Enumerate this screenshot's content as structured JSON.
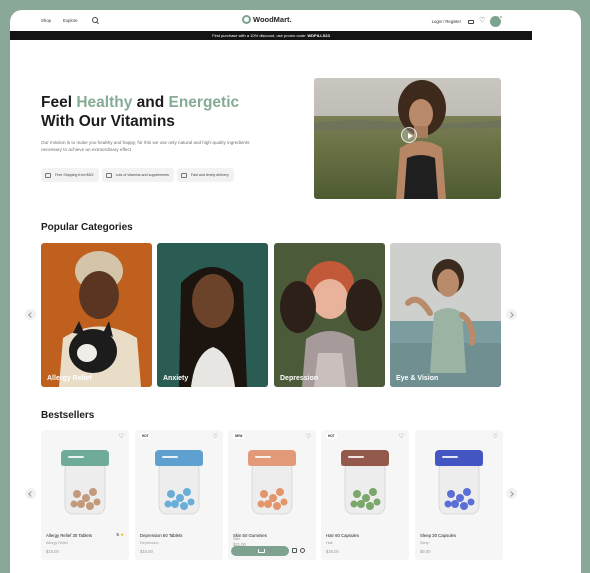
{
  "header": {
    "nav": [
      "Shop",
      "Explore"
    ],
    "logo": "WoodMart.",
    "login": "Login / Register",
    "cart_count": "0"
  },
  "promo": {
    "prefix": "First purchase with a 10% discount, use promo code: ",
    "code": "WDPILLS23"
  },
  "hero": {
    "title_part1": "Feel ",
    "title_green1": "Healthy",
    "title_part2": " and ",
    "title_green2": "Energetic",
    "title_line2": "With Our Vitamins",
    "description": "Our mission is to make you healthy and happy, for this we use only natural and high-quality ingredients necessary to achieve an extraordinary effect",
    "features": [
      "Free Shipping from $30!",
      "Lots of vitamins and supplements",
      "Fast and timely delivery"
    ]
  },
  "categories": {
    "title": "Popular Categories",
    "items": [
      "Allergy Relief",
      "Anxiety",
      "Depression",
      "Eye & Vision"
    ]
  },
  "bestsellers": {
    "title": "Bestsellers",
    "products": [
      {
        "name": "Allergy Relief 30 Tablets",
        "category": "Allergy Relief",
        "price": "$15.00",
        "rating": "5",
        "badge": "",
        "lid": "#6fab9a",
        "pill": "#c39b7c"
      },
      {
        "name": "Depression 60 Tablets",
        "category": "Depression",
        "price": "$15.00",
        "rating": "",
        "badge": "HOT",
        "lid": "#5ea0cf",
        "pill": "#6aaed8"
      },
      {
        "name": "Skin 50 Gummies",
        "category": "Skin",
        "price": "$21.00",
        "rating": "",
        "badge": "NEW",
        "lid": "#e39a78",
        "pill": "#e4956a"
      },
      {
        "name": "Hair 60 Capsules",
        "category": "Hair",
        "price": "$26.00",
        "rating": "",
        "badge": "HOT",
        "lid": "#93594a",
        "pill": "#7aa76a"
      },
      {
        "name": "Sleep 30 Capsules",
        "category": "Sleep",
        "price": "$9.00",
        "rating": "",
        "badge": "",
        "lid": "#4356c2",
        "pill": "#5b6fd4"
      }
    ]
  }
}
